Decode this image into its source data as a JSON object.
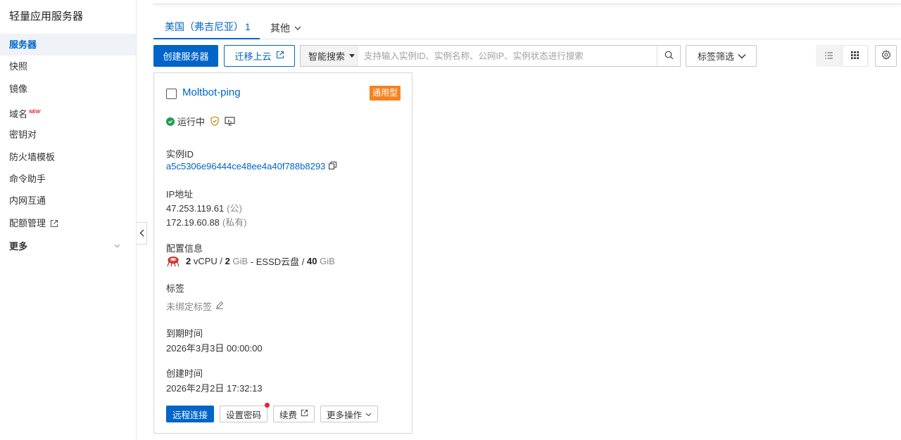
{
  "sidebar": {
    "title": "轻量应用服务器",
    "items": [
      {
        "label": "服务器",
        "active": true
      },
      {
        "label": "快照"
      },
      {
        "label": "镜像"
      },
      {
        "label": "域名",
        "badge": "NEW"
      },
      {
        "label": "密钥对"
      },
      {
        "label": "防火墙模板"
      },
      {
        "label": "命令助手"
      },
      {
        "label": "内网互通"
      },
      {
        "label": "配额管理",
        "icon": "external-link-icon"
      },
      {
        "label": "更多",
        "icon": "chevron-down-icon"
      }
    ]
  },
  "tabs": {
    "region_label": "美国（弗吉尼亚）",
    "region_count": "1",
    "other_label": "其他"
  },
  "toolbar": {
    "create_label": "创建服务器",
    "migrate_label": "迁移上云",
    "search_mode": "智能搜索",
    "search_placeholder": "支持输入实例ID、实例名称、公网IP、实例状态进行搜索",
    "tag_filter_label": "标签筛选"
  },
  "instance": {
    "name": "Moltbot-ping",
    "type_badge": "通用型",
    "status": "运行中",
    "id_label": "实例ID",
    "id": "a5c5306e96444ce48ee4a40f788b8293",
    "ip_label": "IP地址",
    "public_ip": "47.253.119.61",
    "public_tag": "(公)",
    "private_ip": "172.19.60.88",
    "private_tag": "(私有)",
    "config_label": "配置信息",
    "config": {
      "vcpu_count": "2",
      "vcpu_unit": "vCPU /",
      "mem_count": "2",
      "mem_unit": "GiB",
      "disk_text": "- ESSD云盘 /",
      "disk_size": "40",
      "disk_unit": "GiB"
    },
    "tags_label": "标签",
    "tags_value": "未绑定标签",
    "expire_label": "到期时间",
    "expire_value": "2026年3月3日 00:00:00",
    "created_label": "创建时间",
    "created_value": "2026年2月2日 17:32:13"
  },
  "actions": {
    "remote": "远程连接",
    "set_password": "设置密码",
    "renew": "续费",
    "more": "更多操作"
  },
  "colors": {
    "primary": "#0064c8",
    "badge_orange": "#f58220",
    "status_green": "#1f9d4c",
    "new_red": "#e5222f"
  }
}
